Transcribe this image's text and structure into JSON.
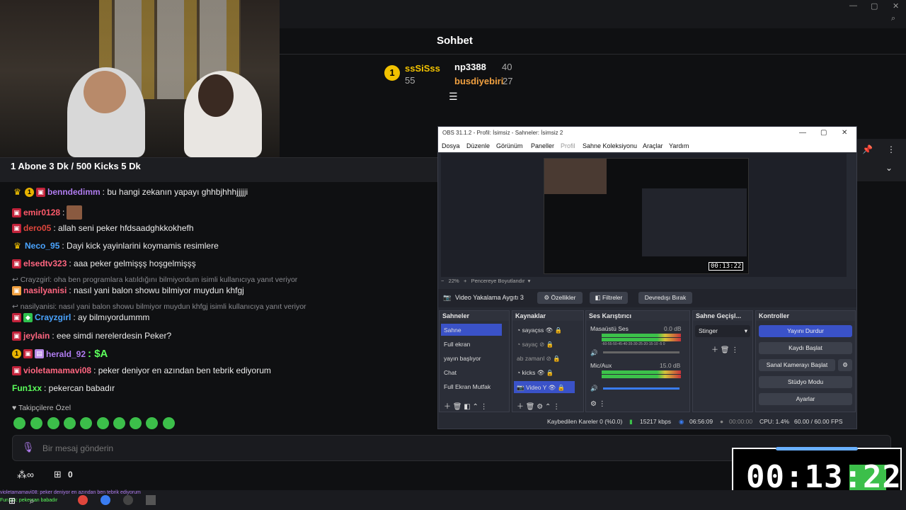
{
  "window": {
    "minimize": "—",
    "maximize": "▢",
    "close": "✕",
    "zoom_icon": "search-icon"
  },
  "chat": {
    "title": "Sohbet",
    "leaderboard": [
      {
        "rank": "1",
        "name": "ssSiSss",
        "count": "55",
        "color": "#f2c200"
      },
      {
        "rank": "",
        "name": "np3388",
        "count": "40",
        "color": "#ffffff"
      },
      {
        "rank": "",
        "name": "busdiyebiri",
        "count": "27",
        "color": "#f0a040"
      }
    ],
    "pinned": "1 Abone 3 Dk / 500 Kicks 5 Dk",
    "messages": [
      {
        "user": "benndedimm",
        "color": "#b07cf0",
        "text": ": bu hangi zekanın yapayı ghhbjhhhjjjjji"
      },
      {
        "user": "emir0128",
        "color": "#ff5a6a",
        "text": ":"
      },
      {
        "user": "dero05",
        "color": "#e0463c",
        "text": ": allah seni peker hfdsaadghkkokhefh"
      },
      {
        "user": "Neco_95",
        "color": "#4aa4ff",
        "text": ": Dayi kick yayinlarini koymamis resimlere"
      },
      {
        "user": "elsedtv323",
        "color": "#ff6680",
        "text": ": aaa peker gelmişşş hoşgelmişşş"
      },
      {
        "user": "nasilyanisi",
        "color": "#ff6680",
        "text": ": nasıl yani balon showu bilmiyor muydun khfgj"
      },
      {
        "user": "Crayzgirl",
        "color": "#4aa4ff",
        "text": ": ay bilmıyordummm"
      },
      {
        "user": "jeylain",
        "color": "#ff6680",
        "text": ": eee simdi nerelerdesin Peker?"
      },
      {
        "user": "herald_92",
        "color": "#b07cf0",
        "text": ": $A"
      },
      {
        "user": "violetamamavi08",
        "color": "#ff6680",
        "text": ": peker deniyor en azından ben tebrik ediyorum"
      },
      {
        "user": "Fun1xx",
        "color": "#5cff5c",
        "text": ": pekercan babadır"
      }
    ],
    "replies": [
      "Crayzgirl: oha ben programlara katıldığını bilmiyordum isimli kullanıcıya yanıt veriyor",
      "nasilyanisi: nasıl yani balon showu bilmiyor muydun khfgj isimli kullanıcıya yanıt veriyor"
    ],
    "followers_only": "Takipçilere Özel",
    "input_placeholder": "Bir mesaj gönderin",
    "kicks_count": "0"
  },
  "obs": {
    "title": "OBS 31.1.2 - Profil: İsimsiz - Sahneler: İsimsiz 2",
    "menu": [
      "Dosya",
      "Düzenle",
      "Görünüm",
      "Paneller",
      "Profil",
      "Sahne Koleksiyonu",
      "Araçlar",
      "Yardım"
    ],
    "zoom": "22%",
    "fit": "Pencereye Boyutlandır",
    "preview_timer": "00:13:22",
    "source_label": "Video Yakalama Aygıtı 3",
    "source_buttons": [
      "Özellikler",
      "Filtreler",
      "Devredışı Bırak"
    ],
    "panels": {
      "scenes": "Sahneler",
      "sources": "Kaynaklar",
      "mixer": "Ses Karıştırıcı",
      "transitions": "Sahne Geçişl...",
      "controls": "Kontroller"
    },
    "scenes": [
      "Sahne",
      "Full ekran",
      "yayın başlıyor",
      "Chat",
      "Full Ekran Mutfak"
    ],
    "sources": [
      "sayaçss",
      "sayaç",
      "zamanl",
      "kicks",
      "Video Y"
    ],
    "mixer": [
      {
        "name": "Masaüstü Ses",
        "db": "0.0 dB"
      },
      {
        "name": "Mic/Aux",
        "db": "15.0 dB"
      }
    ],
    "meter_scale": "-60-55-50-45-40-35-30-25-20-15-10 -5  0",
    "transition": "Stinger",
    "controls": [
      "Yayını Durdur",
      "Kaydı Başlat",
      "Sanal Kamerayı Başlat",
      "Stüdyo Modu",
      "Ayarlar"
    ],
    "status": {
      "dropped": "Kaybedilen Kareler 0 (%0.0)",
      "bitrate": "15217 kbps",
      "live": "06:56:09",
      "rec": "00:00:00",
      "cpu": "CPU: 1.4%",
      "fps": "60.00 / 60.00 FPS"
    }
  },
  "timer_overlay": "00:13:22",
  "taskbar": {
    "ticker": "violetamamavi08: peker deniyor en azından ben tebrik ediyorum",
    "ticker2": "Fun1xx: pekercan babadır"
  }
}
